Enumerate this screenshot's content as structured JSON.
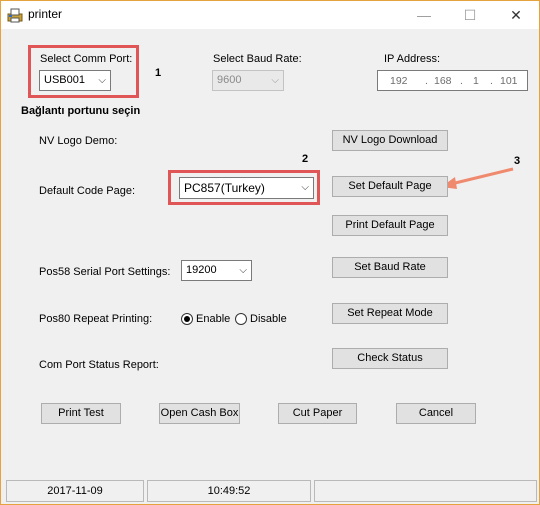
{
  "window": {
    "title": "printer",
    "minimize": "—",
    "maximize": "☐",
    "close": "✕"
  },
  "comm_port": {
    "label": "Select Comm Port:",
    "value": "USB001",
    "annotation_number": "1",
    "hint": "Bağlantı portunu seçin"
  },
  "baud_rate": {
    "label": "Select Baud Rate:",
    "value": "9600"
  },
  "ip": {
    "label": "IP Address:",
    "octets": [
      "192",
      "168",
      "1",
      "101"
    ],
    "separators": [
      ".",
      ".",
      "."
    ]
  },
  "nv_logo": {
    "label": "NV Logo Demo:",
    "button": "NV Logo Download"
  },
  "code_page": {
    "label": "Default Code Page:",
    "value": "PC857(Turkey)",
    "annotation_number": "2",
    "set_button": "Set Default Page",
    "set_annotation_number": "3",
    "print_button": "Print Default Page"
  },
  "pos58": {
    "label": "Pos58 Serial Port Settings:",
    "value": "19200",
    "button": "Set Baud Rate"
  },
  "pos80": {
    "label": "Pos80 Repeat Printing:",
    "enable": "Enable",
    "disable": "Disable",
    "selected": "Enable",
    "button": "Set Repeat Mode"
  },
  "status_report": {
    "label": "Com Port Status Report:",
    "button": "Check Status"
  },
  "bottom_buttons": {
    "print_test": "Print Test",
    "open_cash_box": "Open Cash Box",
    "cut_paper": "Cut Paper",
    "cancel": "Cancel"
  },
  "status_bar": {
    "date": "2017-11-09",
    "time": "10:49:52",
    "message": ""
  },
  "colors": {
    "annotation_red": "#e05555",
    "arrow": "#f08a6e",
    "window_border": "#e6a23c"
  }
}
